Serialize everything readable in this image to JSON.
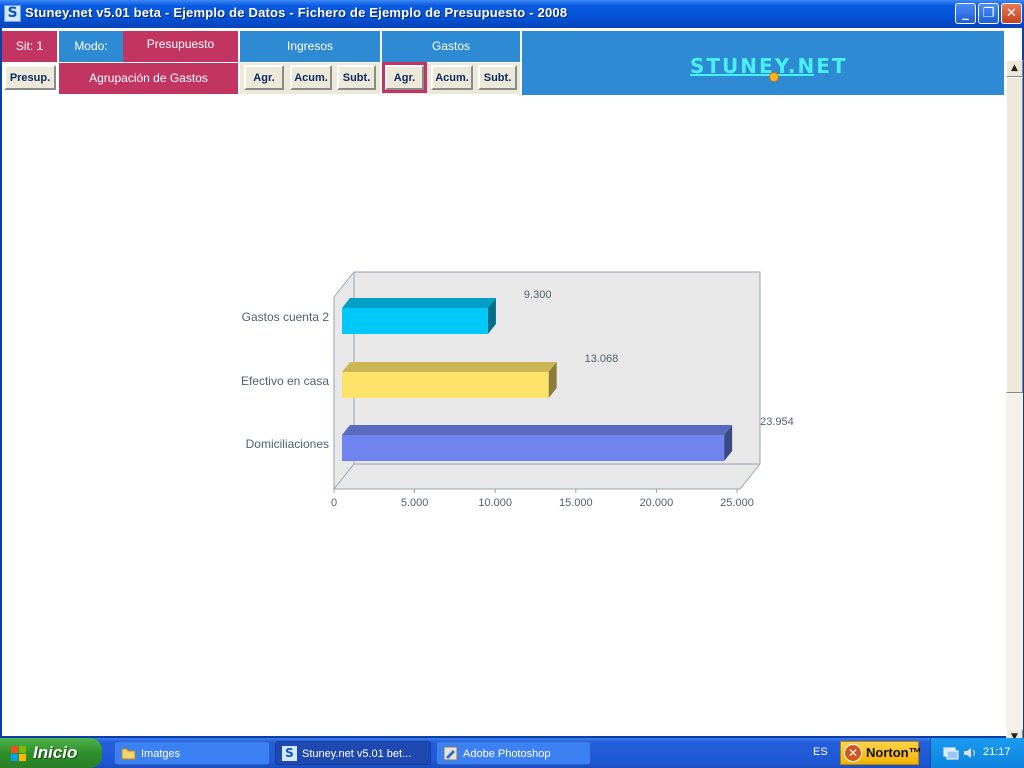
{
  "window": {
    "title": "Stuney.net v5.01 beta - Ejemplo de Datos - Fichero de Ejemplo de Presupuesto - 2008",
    "app_icon": "S",
    "minimize": "_",
    "maximize": "❐",
    "close": "✕"
  },
  "toolbar": {
    "sit": "Sit: 1",
    "modo_label": "Modo:",
    "modo_value": "Presupuesto",
    "ingresos": "Ingresos",
    "gastos": "Gastos",
    "presup_button": "Presup.",
    "agrupacion": "Agrupación de Gastos",
    "ingresos_buttons": [
      "Agr.",
      "Acum.",
      "Subt."
    ],
    "gastos_buttons": [
      "Agr.",
      "Acum.",
      "Subt."
    ],
    "active_button": "gastos-agr",
    "logo_text": "STUNEY.NET"
  },
  "colors": {
    "accent_red": "#c23563",
    "accent_blue": "#2e8ad2",
    "logo_cyan": "#49f0f2"
  },
  "chart_data": {
    "type": "bar",
    "orientation": "horizontal",
    "style": "3d",
    "categories": [
      "Gastos cuenta 2",
      "Efectivo en casa",
      "Domiciliaciones"
    ],
    "values": [
      9300,
      13068,
      23954
    ],
    "value_labels": [
      "9.300",
      "13.068",
      "23.954"
    ],
    "bar_colors": [
      "#00c8f8",
      "#ffe26a",
      "#6f84ef"
    ],
    "x_ticks": [
      "0",
      "5.000",
      "10.000",
      "15.000",
      "20.000",
      "25.000"
    ],
    "xlim": [
      0,
      25000
    ],
    "grid": false
  },
  "taskbar": {
    "start": "Inicio",
    "tasks": [
      {
        "label": "Imatges",
        "icon": "folder-icon"
      },
      {
        "label": "Stuney.net v5.01 bet...",
        "icon": "stuney-icon"
      },
      {
        "label": "Adobe Photoshop",
        "icon": "photoshop-icon"
      }
    ],
    "language": "ES",
    "norton": "Norton™",
    "clock": "21:17"
  }
}
